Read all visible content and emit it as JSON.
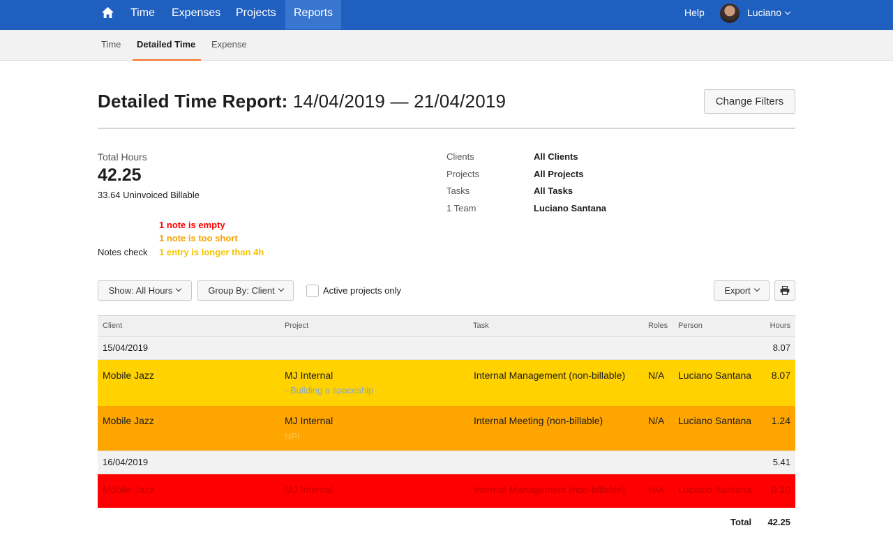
{
  "colors": {
    "nav_bg": "#1f5fbf",
    "nav_active": "#3876d0",
    "accent_orange": "#f36c21",
    "row_yellow": "#ffd200",
    "row_orange": "#ffa500",
    "row_red": "#ff0000",
    "note_red": "#ff0000",
    "note_orange": "#f5a300",
    "note_yellow": "#f5c400"
  },
  "topnav": {
    "home_icon": "home-icon",
    "items": [
      {
        "label": "Time"
      },
      {
        "label": "Expenses"
      },
      {
        "label": "Projects"
      },
      {
        "label": "Reports",
        "active": true
      }
    ],
    "help": "Help",
    "user": "Luciano"
  },
  "subnav": {
    "items": [
      {
        "label": "Time"
      },
      {
        "label": "Detailed Time",
        "active": true
      },
      {
        "label": "Expense"
      }
    ]
  },
  "header": {
    "title_bold": "Detailed Time Report:",
    "date_range": "14/04/2019 — 21/04/2019",
    "change_filters": "Change Filters"
  },
  "summary": {
    "total_label": "Total Hours",
    "total_value": "42.25",
    "uninvoiced": "33.64 Uninvoiced Billable",
    "notes_check_label": "Notes check",
    "notes": [
      {
        "text": "1 note is empty",
        "level": "red"
      },
      {
        "text": "1 note is too short",
        "level": "orange"
      },
      {
        "text": "1 entry is longer than 4h",
        "level": "yellow"
      }
    ],
    "filters": [
      {
        "label": "Clients",
        "value": "All Clients"
      },
      {
        "label": "Projects",
        "value": "All Projects"
      },
      {
        "label": "Tasks",
        "value": "All Tasks"
      },
      {
        "label": "1 Team",
        "value": "Luciano Santana"
      }
    ]
  },
  "controls": {
    "show": "Show: All Hours",
    "group_by": "Group By: Client",
    "active_only": "Active projects only",
    "active_only_checked": false,
    "export": "Export",
    "print_icon": "print-icon"
  },
  "table": {
    "columns": [
      "Client",
      "Project",
      "Task",
      "Roles",
      "Person",
      "Hours"
    ],
    "groups": [
      {
        "date": "15/04/2019",
        "hours": "8.07",
        "rows": [
          {
            "client": "Mobile Jazz",
            "project": "MJ Internal",
            "note": "- Building a spaceship",
            "task": "Internal Management (non-billable)",
            "roles": "N/A",
            "person": "Luciano Santana",
            "hours": "8.07",
            "color": "yellow"
          },
          {
            "client": "Mobile Jazz",
            "project": "MJ Internal",
            "note": "NPI",
            "task": "Internal Meeting (non-billable)",
            "roles": "N/A",
            "person": "Luciano Santana",
            "hours": "1.24",
            "color": "orange"
          }
        ]
      },
      {
        "date": "16/04/2019",
        "hours": "5.41",
        "rows": [
          {
            "client": "Mobile Jazz",
            "project": "MJ Internal",
            "note": "",
            "task": "Internal Management (non-billable)",
            "roles": "N/A",
            "person": "Luciano Santana",
            "hours": "0.10",
            "color": "red"
          }
        ]
      }
    ],
    "total_label": "Total",
    "total_value": "42.25"
  }
}
